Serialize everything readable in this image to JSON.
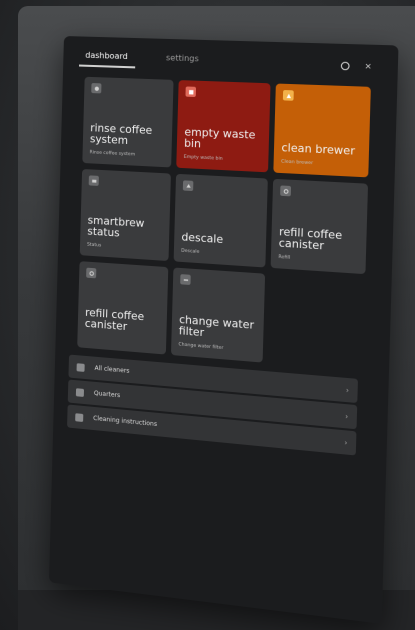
{
  "tabs": {
    "dashboard": "dashboard",
    "settings": "settings"
  },
  "window": {
    "icons": [
      "circle-icon",
      "close-icon"
    ],
    "close_glyph": "×"
  },
  "tiles": [
    {
      "title": "rinse coffee system",
      "sub": "Rinse coffee system",
      "icon": "rinse-icon",
      "color": "#3a3b3d"
    },
    {
      "title": "empty waste bin",
      "sub": "Empty waste bin",
      "icon": "bin-icon",
      "color": "#8e1b12"
    },
    {
      "title": "clean brewer",
      "sub": "Clean brewer",
      "icon": "brewer-icon",
      "color": "#c45f07"
    },
    {
      "title": "smartbrew status",
      "sub": "Status",
      "icon": "status-icon",
      "color": "#3a3b3d"
    },
    {
      "title": "descale",
      "sub": "Descale",
      "icon": "descale-icon",
      "color": "#3a3b3d"
    },
    {
      "title": "refill coffee canister",
      "sub": "Refill",
      "icon": "canister-icon",
      "color": "#3a3b3d"
    },
    {
      "title": "refill coffee canister",
      "sub": "",
      "icon": "canister-icon",
      "color": "#3a3b3d"
    },
    {
      "title": "change water filter",
      "sub": "Change water filter",
      "icon": "filter-icon",
      "color": "#3a3b3d"
    }
  ],
  "list": [
    {
      "label": "All cleaners",
      "icon": "cleaners-icon"
    },
    {
      "label": "Quarters",
      "icon": "quarters-icon"
    },
    {
      "label": "Cleaning instructions",
      "icon": "instructions-icon"
    }
  ],
  "chevron": "›"
}
